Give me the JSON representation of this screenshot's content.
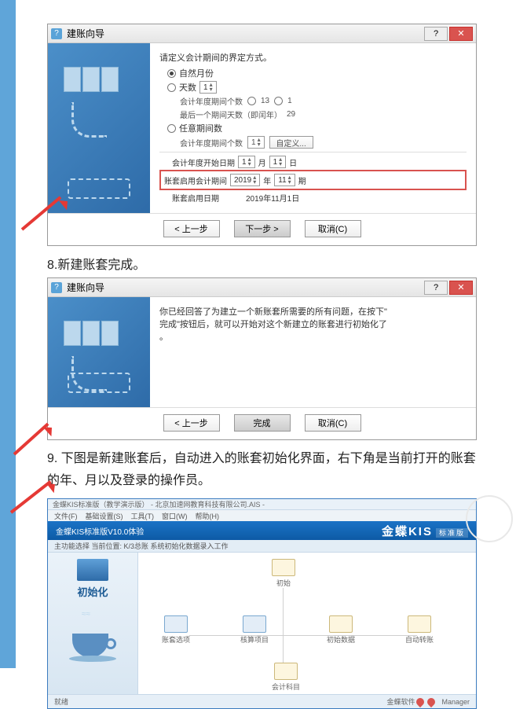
{
  "leftbar_accent": "#5fa5d9",
  "dialog1": {
    "title": "建账向导",
    "question": "请定义会计期间的界定方式。",
    "opt_natural": "自然月份",
    "opt_days": "天数",
    "days_value": "1",
    "sub_period_count": "会计年度期间个数",
    "sub_last_days": "最后一个期间天数（即闰年）",
    "last_days_val": "29",
    "radio_13": "13",
    "radio_1_alt": "1",
    "opt_free_count": "任意期间数",
    "free_count_label": "会计年度期间个数",
    "free_count_val": "1",
    "custom_btn": "自定义...",
    "fy_start_label": "会计年度开始日期",
    "fy_start_val": "1",
    "fy_month": "月",
    "fy_month_val": "1",
    "fy_day": "日",
    "enable_label": "账套启用会计期间",
    "enable_year": "2019",
    "enable_year_unit": "年",
    "enable_period": "11",
    "enable_period_unit": "期",
    "enable_date_label": "账套启用日期",
    "enable_date_val": "2019年11月1日",
    "btn_prev": "< 上一步",
    "btn_next": "下一步 >",
    "btn_cancel": "取消(C)"
  },
  "caption8": "8.新建账套完成。",
  "dialog2": {
    "title": "建账向导",
    "body_l1": "你已经回答了为建立一个新账套所需要的所有问题，在按下\"",
    "body_l2": "完成\"按钮后，就可以开始对这个新建立的账套进行初始化了",
    "body_l3": "。",
    "btn_prev": "< 上一步",
    "btn_finish": "完成",
    "btn_cancel": "取消(C)"
  },
  "caption9": "9. 下图是新建账套后，自动进入的账套初始化界面，右下角是当前打开的账套的年、月以及登录的操作员。",
  "app": {
    "top_text": "金蝶KIS标准版（教学演示版） - 北京加速网教育科技有限公司.AIS - ",
    "menu": [
      "文件(F)",
      "基础设置(S)",
      "工具(T)",
      "窗口(W)",
      "帮助(H)"
    ],
    "titlebar_left": "金蝶KIS标准版V10.0体验",
    "brand": "金蝶KIS",
    "brand_tag": "标准版",
    "tool_text": "主功能选择  当前位置: K/3总账  系统初始化数据录入工作",
    "side_title": "初始化",
    "nodes": {
      "n1": "初始",
      "n2": "账套选项",
      "n3": "核算项目",
      "n4": "初始数据",
      "n5": "自动转账",
      "n6": "会计科目"
    },
    "status_left": "就绪",
    "status_mid": "金蝶软件",
    "status_user": "Manager"
  }
}
